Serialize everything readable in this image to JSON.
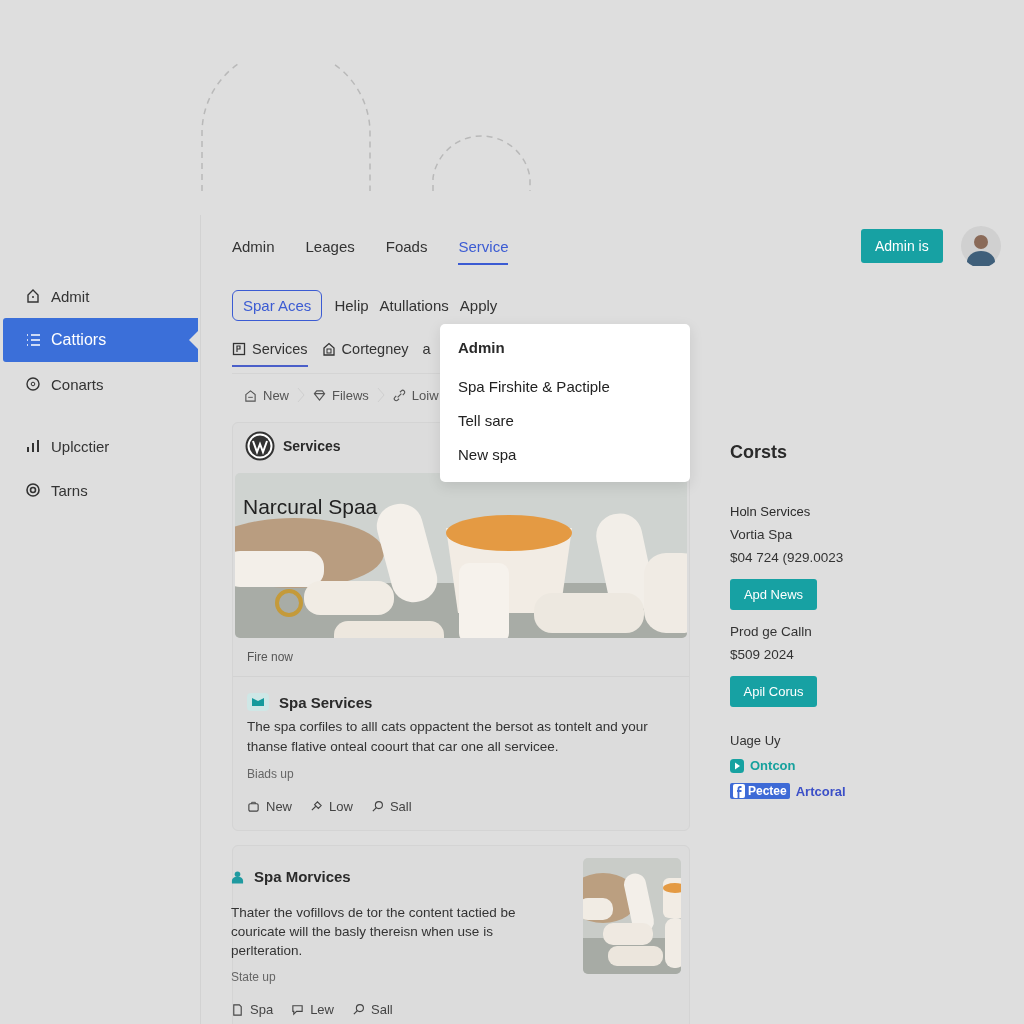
{
  "sidebar": {
    "items": [
      {
        "label": "Admit",
        "selected": false
      },
      {
        "label": "Cattiors",
        "selected": true
      },
      {
        "label": "Conarts",
        "selected": false
      },
      {
        "label": "Uplcctier",
        "selected": false
      },
      {
        "label": "Tarns",
        "selected": false
      }
    ]
  },
  "tabs": [
    {
      "label": "Admin",
      "selected": false
    },
    {
      "label": "Leages",
      "selected": false
    },
    {
      "label": "Foads",
      "selected": false
    },
    {
      "label": "Service",
      "selected": true
    }
  ],
  "sub_tabs": [
    {
      "label": "Spar Aces",
      "selected": true
    },
    {
      "label": "Helip",
      "selected": false
    },
    {
      "label": "Atullations",
      "selected": false
    },
    {
      "label": "Apply",
      "selected": false
    }
  ],
  "section_tabs": [
    {
      "label": "Services",
      "selected": true
    },
    {
      "label": "Cortegney",
      "selected": false
    },
    {
      "label": "a",
      "selected": false
    }
  ],
  "breadcrumbs": [
    "New",
    "Filews",
    "Loiw"
  ],
  "dropdown": {
    "title": "Admin",
    "items": [
      "Spa Firshite & Pactiple",
      "Tell sare",
      "New spa"
    ]
  },
  "feature_card": {
    "title": "Services",
    "picture_caption": "Narcural Spaa",
    "footer": "Fire now",
    "section": {
      "title": "Spa Services",
      "text": "The spa corfiles to alll cats oppactent the bersot as tontelt and your thanse flative onteal coourt that car one all servicee.",
      "meta": "Biads up",
      "actions": [
        "New",
        "Low",
        "Sall"
      ]
    }
  },
  "second_card": {
    "title": "Spa Morvices",
    "text": "Thater the vofillovs de tor the content tactied be couricate will the basly thereisn when use is perlteration.",
    "meta": "State up",
    "actions": [
      "Spa",
      "Lew",
      "Sall"
    ]
  },
  "header_button": "Admin is",
  "aside": {
    "title": "Corsts",
    "subtitle": "Holn Services",
    "entries": [
      {
        "name": "Vortia Spa",
        "value": "$04 724 (929.0023",
        "button": "Apd News"
      },
      {
        "name": "Prod ge Calln",
        "value": "$509 2024",
        "button": "Apil Corus"
      }
    ],
    "label": "Uage Uy",
    "link": "Ontcon",
    "badge": "Pectee",
    "badge_link": "Artcoral"
  }
}
